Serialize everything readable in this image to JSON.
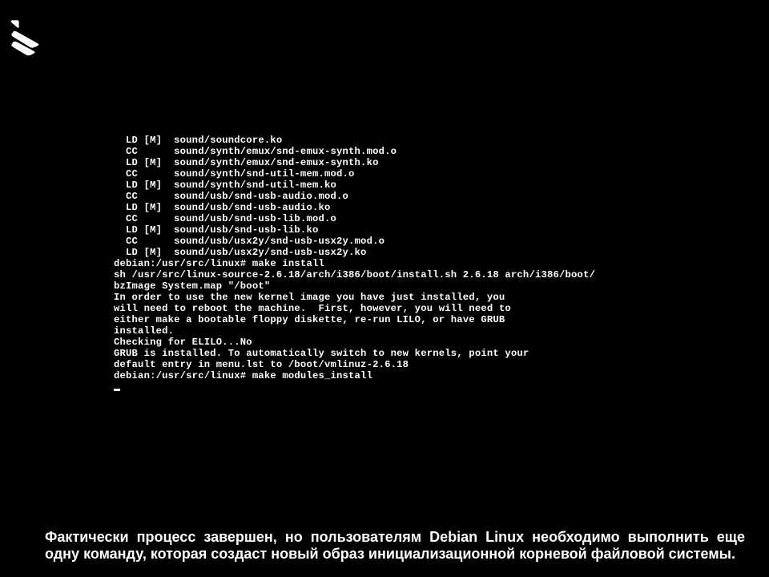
{
  "terminal": {
    "build_lines": [
      {
        "tag": "LD [M]",
        "path": "sound/soundcore.ko"
      },
      {
        "tag": "CC",
        "path": "sound/synth/emux/snd-emux-synth.mod.o"
      },
      {
        "tag": "LD [M]",
        "path": "sound/synth/emux/snd-emux-synth.ko"
      },
      {
        "tag": "CC",
        "path": "sound/synth/snd-util-mem.mod.o"
      },
      {
        "tag": "LD [M]",
        "path": "sound/synth/snd-util-mem.ko"
      },
      {
        "tag": "CC",
        "path": "sound/usb/snd-usb-audio.mod.o"
      },
      {
        "tag": "LD [M]",
        "path": "sound/usb/snd-usb-audio.ko"
      },
      {
        "tag": "CC",
        "path": "sound/usb/snd-usb-lib.mod.o"
      },
      {
        "tag": "LD [M]",
        "path": "sound/usb/snd-usb-lib.ko"
      },
      {
        "tag": "CC",
        "path": "sound/usb/usx2y/snd-usb-usx2y.mod.o"
      },
      {
        "tag": "LD [M]",
        "path": "sound/usb/usx2y/snd-usb-usx2y.ko"
      }
    ],
    "prompt1": "debian:/usr/src/linux# make install",
    "msg1": "sh /usr/src/linux-source-2.6.18/arch/i386/boot/install.sh 2.6.18 arch/i386/boot/",
    "msg2": "bzImage System.map \"/boot\"",
    "msg3": "In order to use the new kernel image you have just installed, you",
    "msg4": "will need to reboot the machine.  First, however, you will need to",
    "msg5": "either make a bootable floppy diskette, re-run LILO, or have GRUB",
    "msg6": "installed.",
    "blank1": "",
    "msg7": "Checking for ELILO...No",
    "blank2": "",
    "msg8": "GRUB is installed. To automatically switch to new kernels, point your",
    "msg9": "default entry in menu.lst to /boot/vmlinuz-2.6.18",
    "prompt2": "debian:/usr/src/linux# make modules_install"
  },
  "caption": "Фактически процесс завершен, но пользователям Debian Linux необходимо выполнить еще одну команду, которая создаст новый образ инициализационной корневой файловой системы."
}
